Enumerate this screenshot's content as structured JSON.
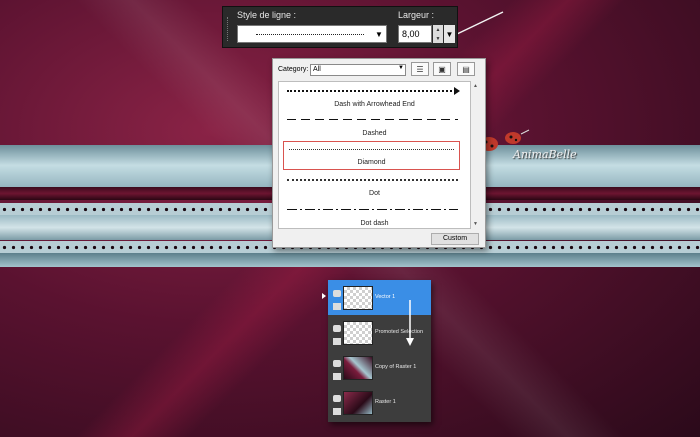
{
  "toolbar": {
    "line_style_label": "Style de ligne :",
    "width_label": "Largeur :",
    "width_value": "8,00"
  },
  "line_style_panel": {
    "category_label": "Category:",
    "category_value": "All",
    "items": [
      {
        "label": "Dash with Arrowhead End"
      },
      {
        "label": "Dashed"
      },
      {
        "label": "Diamond"
      },
      {
        "label": "Dot"
      },
      {
        "label": "Dot dash"
      }
    ],
    "selected_item": "Diamond",
    "custom_button": "Custom"
  },
  "layers": [
    {
      "name": "Vector 1",
      "selected": true
    },
    {
      "name": "Promoted Selection",
      "selected": false
    },
    {
      "name": "Copy of Raster 1",
      "selected": false
    },
    {
      "name": "Raster 1",
      "selected": false
    }
  ],
  "watermark": "AnimaBelle",
  "colors": {
    "selection_highlight": "#3a8ee6",
    "selected_item_border": "#d9534f",
    "dark_panel": "#3d3d3d"
  }
}
